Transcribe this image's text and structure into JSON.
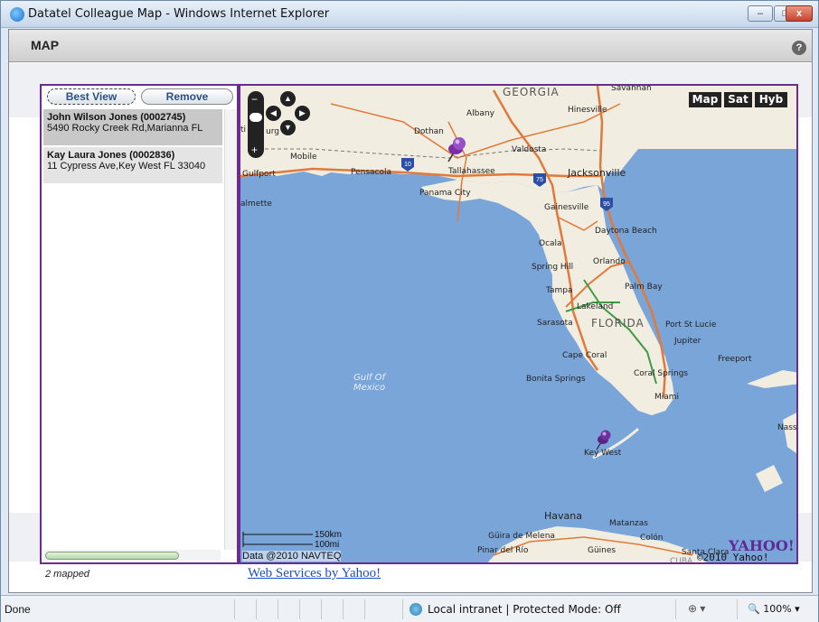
{
  "window": {
    "title": "Datatel Colleague Map - Windows Internet Explorer",
    "minimize": "–",
    "maximize": "□",
    "close": "x"
  },
  "header": {
    "title": "MAP",
    "help": "?"
  },
  "left_panel": {
    "best_view_label": "Best View",
    "remove_label": "Remove",
    "items": [
      {
        "name": "John Wilson Jones (0002745)",
        "address": "5490 Rocky Creek Rd,Marianna FL"
      },
      {
        "name": "Kay Laura Jones (0002836)",
        "address": "11 Cypress Ave,Key West FL 33040"
      }
    ]
  },
  "map": {
    "type_buttons": [
      "Map",
      "Sat",
      "Hyb"
    ],
    "scale_km": "150km",
    "scale_mi": "100mi",
    "data_copyright": "Data @2010 NAVTEQ",
    "yahoo_logo": "YAHOO!",
    "yahoo_copyright": "©2010 Yahoo! Inc.",
    "states": [
      "GEORGIA",
      "FLORIDA"
    ],
    "gulf": "Gulf Of\nMexico",
    "cities": [
      "Savannah",
      "Hinesville",
      "Albany",
      "Dothan",
      "Valdosta",
      "Mobile",
      "Pensacola",
      "Tallahassee",
      "Jacksonville",
      "Gulfport",
      "Panama City",
      "Gainesville",
      "Daytona Beach",
      "Ocala",
      "Orlando",
      "Spring Hill",
      "Palm Bay",
      "Tampa",
      "Lakeland",
      "Sarasota",
      "Port St Lucie",
      "Jupiter",
      "Freeport",
      "Cape Coral",
      "Coral Springs",
      "Bonita Springs",
      "Miami",
      "Key West",
      "Nass",
      "Havana",
      "Matanzas",
      "Güira de Melena",
      "Colón",
      "Pinar del Río",
      "Güines",
      "Santa Clara",
      "almette",
      "ti",
      "urg",
      "CUBA"
    ]
  },
  "footer": {
    "mapped_count": "2 mapped",
    "yahoo_link": "Web Services by Yahoo!"
  },
  "statusbar": {
    "done": "Done",
    "zone": "Local intranet | Protected Mode: Off",
    "fav": "⊕ ▾",
    "zoom": "🔍 100%  ▾"
  },
  "colors": {
    "panel_border": "#6a2c8e",
    "water": "#7aa5d9",
    "land": "#f2eee2",
    "pin": "#8b3fb8"
  }
}
